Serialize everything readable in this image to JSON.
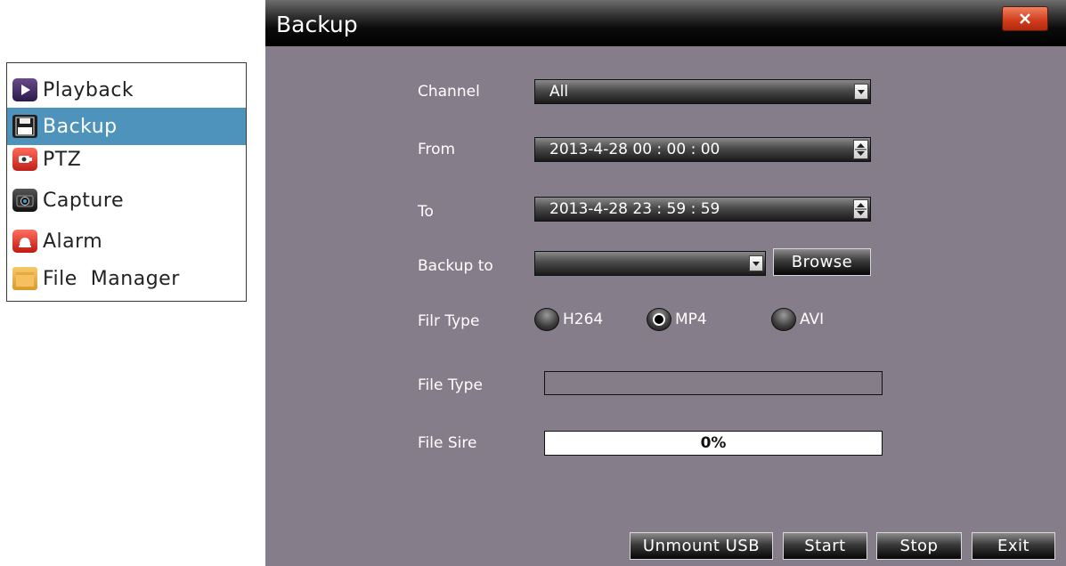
{
  "menu": {
    "items": [
      {
        "label": "Playback",
        "icon": "play-icon",
        "selected": false
      },
      {
        "label": "Backup",
        "icon": "floppy-disk-icon",
        "selected": true
      },
      {
        "label": "PTZ",
        "icon": "camera-dome-icon",
        "selected": false
      },
      {
        "label": "Capture",
        "icon": "camera-icon",
        "selected": false
      },
      {
        "label": "Alarm",
        "icon": "alarm-icon",
        "selected": false
      },
      {
        "label": "File  Manager",
        "icon": "folder-icon",
        "selected": false
      }
    ]
  },
  "dialog": {
    "title": "Backup",
    "close_icon": "close-icon",
    "channel": {
      "label": "Channel",
      "value": "All"
    },
    "from": {
      "label": "From",
      "value": "2013-4-28 00 : 00 : 00"
    },
    "to": {
      "label": "To",
      "value": "2013-4-28 23 : 59 : 59"
    },
    "backup_to": {
      "label": "Backup to",
      "value": "",
      "browse_label": "Browse"
    },
    "filr_type": {
      "label": "Filr Type",
      "options": [
        {
          "label": "H264",
          "checked": false
        },
        {
          "label": "MP4",
          "checked": true
        },
        {
          "label": "AVI",
          "checked": false
        }
      ]
    },
    "file_type": {
      "label": "File Type",
      "value": ""
    },
    "file_sire": {
      "label": "File Sire",
      "progress_text": "0%",
      "progress": 0
    },
    "buttons": {
      "unmount": "Unmount USB",
      "start": "Start",
      "stop": "Stop",
      "exit": "Exit"
    }
  },
  "colors": {
    "dialog_bg": "#867d8a",
    "selected_bg": "#4e93bb",
    "close_bg": "#d03b1a"
  }
}
